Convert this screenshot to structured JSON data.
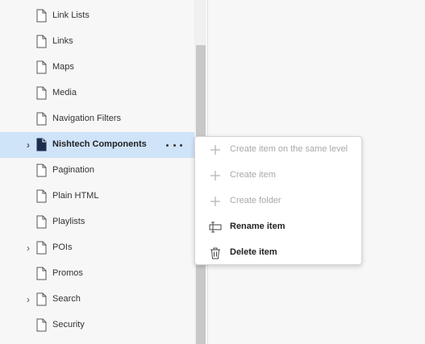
{
  "tree": {
    "items": [
      {
        "label": "Link Lists",
        "icon": "document-icon",
        "expandable": false,
        "selected": false
      },
      {
        "label": "Links",
        "icon": "document-icon",
        "expandable": false,
        "selected": false
      },
      {
        "label": "Maps",
        "icon": "document-icon",
        "expandable": false,
        "selected": false
      },
      {
        "label": "Media",
        "icon": "document-icon",
        "expandable": false,
        "selected": false
      },
      {
        "label": "Navigation Filters",
        "icon": "document-icon",
        "expandable": false,
        "selected": false
      },
      {
        "label": "Nishtech Components",
        "icon": "document-filled-icon",
        "expandable": true,
        "selected": true
      },
      {
        "label": "Pagination",
        "icon": "document-icon",
        "expandable": false,
        "selected": false
      },
      {
        "label": "Plain HTML",
        "icon": "document-icon",
        "expandable": false,
        "selected": false
      },
      {
        "label": "Playlists",
        "icon": "document-icon",
        "expandable": false,
        "selected": false
      },
      {
        "label": "POIs",
        "icon": "document-icon",
        "expandable": true,
        "selected": false
      },
      {
        "label": "Promos",
        "icon": "document-icon",
        "expandable": false,
        "selected": false
      },
      {
        "label": "Search",
        "icon": "document-icon",
        "expandable": true,
        "selected": false
      },
      {
        "label": "Security",
        "icon": "document-icon",
        "expandable": false,
        "selected": false
      }
    ],
    "chevron_glyph": "›",
    "selected_background": "#cfe3f9"
  },
  "context_menu": {
    "items": [
      {
        "label": "Create item on the same level",
        "icon": "plus-icon",
        "enabled": false
      },
      {
        "label": "Create item",
        "icon": "plus-icon",
        "enabled": false
      },
      {
        "label": "Create folder",
        "icon": "plus-icon",
        "enabled": false
      },
      {
        "label": "Rename item",
        "icon": "rename-icon",
        "enabled": true
      },
      {
        "label": "Delete item",
        "icon": "trash-icon",
        "enabled": true
      }
    ]
  }
}
